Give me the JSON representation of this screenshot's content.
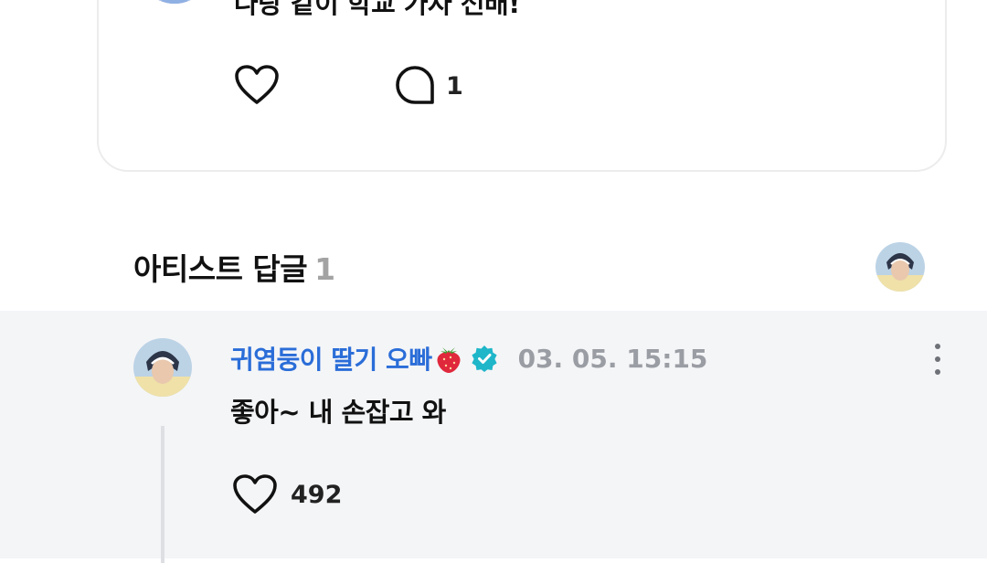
{
  "post": {
    "text": "나랑 같이 학교 가자 선배!",
    "actions": {
      "like_icon": "heart-outline-icon",
      "comment_icon": "comment-bubble-icon",
      "comment_count": "1"
    }
  },
  "artist_replies": {
    "title": "아티스트 답글",
    "count": "1"
  },
  "reply": {
    "author": "귀염둥이 딸기 오빠",
    "author_emoji": "strawberry-icon",
    "verified_badge": "verified-check-icon",
    "timestamp": "03. 05. 15:15",
    "text": "좋아~ 내 손잡고 와",
    "like_count": "492",
    "menu_icon": "more-vertical-icon"
  },
  "colors": {
    "artist_name": "#2a6dd8",
    "verified_badge": "#1fb6c9",
    "reply_background": "#f4f5f7",
    "muted_text": "#9a9da3",
    "card_border": "#ececec"
  }
}
